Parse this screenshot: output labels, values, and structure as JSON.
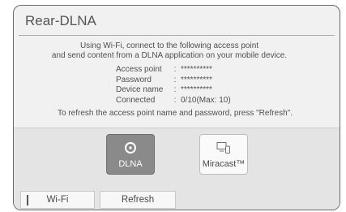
{
  "title": "Rear-DLNA",
  "message_line1": "Using Wi-Fi, connect to the following access point",
  "message_line2": "and send content from a DLNA application on your mobile device.",
  "info": [
    {
      "label": "Access point",
      "sep": ":",
      "value": "**********"
    },
    {
      "label": "Password",
      "sep": ":",
      "value": "**********"
    },
    {
      "label": "Device name",
      "sep": ":",
      "value": "**********"
    },
    {
      "label": "Connected",
      "sep": ":",
      "value": "0/10(Max: 10)"
    }
  ],
  "refresh_hint": "To refresh the access point name and password, press \"Refresh\".",
  "tiles": {
    "dlna": {
      "label": "DLNA",
      "icon": "dlna-icon",
      "selected": true
    },
    "miracast": {
      "label": "Miracast™",
      "icon": "miracast-icon",
      "selected": false
    }
  },
  "buttons": {
    "wifi": "Wi-Fi",
    "refresh": "Refresh"
  },
  "colors": {
    "screen_bg": "#f1f1f1",
    "selected_tile": "#8a8a8a",
    "text": "#505050"
  }
}
